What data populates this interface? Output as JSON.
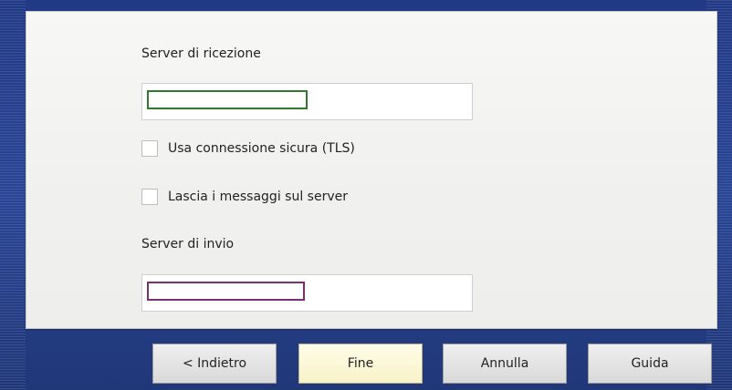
{
  "form": {
    "incoming_server_label": "Server di ricezione",
    "incoming_server_value": "",
    "tls_label": "Usa connessione sicura (TLS)",
    "keep_messages_label": "Lascia i messaggi sul server",
    "outgoing_server_label": "Server di invio",
    "outgoing_server_value": ""
  },
  "buttons": {
    "back_label": "< Indietro",
    "finish_label": "Fine",
    "cancel_label": "Annulla",
    "help_label": "Guida"
  },
  "colors": {
    "background": "#223a86",
    "panel": "#f3f3f1",
    "incoming_field_border": "#2f7a2f",
    "outgoing_field_border": "#7a2f6e",
    "primary_button": "#fbf6d6"
  }
}
